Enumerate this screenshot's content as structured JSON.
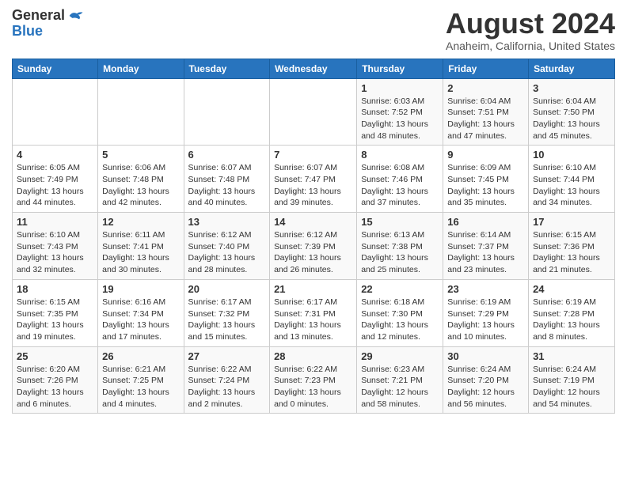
{
  "logo": {
    "line1": "General",
    "line2": "Blue"
  },
  "title": "August 2024",
  "location": "Anaheim, California, United States",
  "days_of_week": [
    "Sunday",
    "Monday",
    "Tuesday",
    "Wednesday",
    "Thursday",
    "Friday",
    "Saturday"
  ],
  "weeks": [
    [
      {
        "num": "",
        "info": ""
      },
      {
        "num": "",
        "info": ""
      },
      {
        "num": "",
        "info": ""
      },
      {
        "num": "",
        "info": ""
      },
      {
        "num": "1",
        "info": "Sunrise: 6:03 AM\nSunset: 7:52 PM\nDaylight: 13 hours and 48 minutes."
      },
      {
        "num": "2",
        "info": "Sunrise: 6:04 AM\nSunset: 7:51 PM\nDaylight: 13 hours and 47 minutes."
      },
      {
        "num": "3",
        "info": "Sunrise: 6:04 AM\nSunset: 7:50 PM\nDaylight: 13 hours and 45 minutes."
      }
    ],
    [
      {
        "num": "4",
        "info": "Sunrise: 6:05 AM\nSunset: 7:49 PM\nDaylight: 13 hours and 44 minutes."
      },
      {
        "num": "5",
        "info": "Sunrise: 6:06 AM\nSunset: 7:48 PM\nDaylight: 13 hours and 42 minutes."
      },
      {
        "num": "6",
        "info": "Sunrise: 6:07 AM\nSunset: 7:48 PM\nDaylight: 13 hours and 40 minutes."
      },
      {
        "num": "7",
        "info": "Sunrise: 6:07 AM\nSunset: 7:47 PM\nDaylight: 13 hours and 39 minutes."
      },
      {
        "num": "8",
        "info": "Sunrise: 6:08 AM\nSunset: 7:46 PM\nDaylight: 13 hours and 37 minutes."
      },
      {
        "num": "9",
        "info": "Sunrise: 6:09 AM\nSunset: 7:45 PM\nDaylight: 13 hours and 35 minutes."
      },
      {
        "num": "10",
        "info": "Sunrise: 6:10 AM\nSunset: 7:44 PM\nDaylight: 13 hours and 34 minutes."
      }
    ],
    [
      {
        "num": "11",
        "info": "Sunrise: 6:10 AM\nSunset: 7:43 PM\nDaylight: 13 hours and 32 minutes."
      },
      {
        "num": "12",
        "info": "Sunrise: 6:11 AM\nSunset: 7:41 PM\nDaylight: 13 hours and 30 minutes."
      },
      {
        "num": "13",
        "info": "Sunrise: 6:12 AM\nSunset: 7:40 PM\nDaylight: 13 hours and 28 minutes."
      },
      {
        "num": "14",
        "info": "Sunrise: 6:12 AM\nSunset: 7:39 PM\nDaylight: 13 hours and 26 minutes."
      },
      {
        "num": "15",
        "info": "Sunrise: 6:13 AM\nSunset: 7:38 PM\nDaylight: 13 hours and 25 minutes."
      },
      {
        "num": "16",
        "info": "Sunrise: 6:14 AM\nSunset: 7:37 PM\nDaylight: 13 hours and 23 minutes."
      },
      {
        "num": "17",
        "info": "Sunrise: 6:15 AM\nSunset: 7:36 PM\nDaylight: 13 hours and 21 minutes."
      }
    ],
    [
      {
        "num": "18",
        "info": "Sunrise: 6:15 AM\nSunset: 7:35 PM\nDaylight: 13 hours and 19 minutes."
      },
      {
        "num": "19",
        "info": "Sunrise: 6:16 AM\nSunset: 7:34 PM\nDaylight: 13 hours and 17 minutes."
      },
      {
        "num": "20",
        "info": "Sunrise: 6:17 AM\nSunset: 7:32 PM\nDaylight: 13 hours and 15 minutes."
      },
      {
        "num": "21",
        "info": "Sunrise: 6:17 AM\nSunset: 7:31 PM\nDaylight: 13 hours and 13 minutes."
      },
      {
        "num": "22",
        "info": "Sunrise: 6:18 AM\nSunset: 7:30 PM\nDaylight: 13 hours and 12 minutes."
      },
      {
        "num": "23",
        "info": "Sunrise: 6:19 AM\nSunset: 7:29 PM\nDaylight: 13 hours and 10 minutes."
      },
      {
        "num": "24",
        "info": "Sunrise: 6:19 AM\nSunset: 7:28 PM\nDaylight: 13 hours and 8 minutes."
      }
    ],
    [
      {
        "num": "25",
        "info": "Sunrise: 6:20 AM\nSunset: 7:26 PM\nDaylight: 13 hours and 6 minutes."
      },
      {
        "num": "26",
        "info": "Sunrise: 6:21 AM\nSunset: 7:25 PM\nDaylight: 13 hours and 4 minutes."
      },
      {
        "num": "27",
        "info": "Sunrise: 6:22 AM\nSunset: 7:24 PM\nDaylight: 13 hours and 2 minutes."
      },
      {
        "num": "28",
        "info": "Sunrise: 6:22 AM\nSunset: 7:23 PM\nDaylight: 13 hours and 0 minutes."
      },
      {
        "num": "29",
        "info": "Sunrise: 6:23 AM\nSunset: 7:21 PM\nDaylight: 12 hours and 58 minutes."
      },
      {
        "num": "30",
        "info": "Sunrise: 6:24 AM\nSunset: 7:20 PM\nDaylight: 12 hours and 56 minutes."
      },
      {
        "num": "31",
        "info": "Sunrise: 6:24 AM\nSunset: 7:19 PM\nDaylight: 12 hours and 54 minutes."
      }
    ]
  ]
}
